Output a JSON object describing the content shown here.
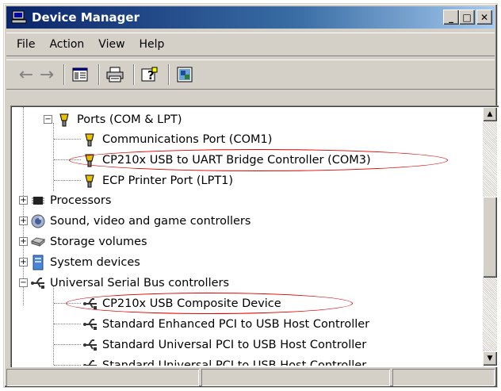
{
  "window": {
    "title": "Device Manager",
    "controls": {
      "minimize": "_",
      "maximize": "□",
      "close": "✕"
    }
  },
  "menu": [
    {
      "label": "File"
    },
    {
      "label": "Action"
    },
    {
      "label": "View"
    },
    {
      "label": "Help"
    }
  ],
  "toolbar": {
    "icons": [
      "back-arrow-icon",
      "forward-arrow-icon",
      "properties-icon",
      "print-icon",
      "help-icon",
      "update-driver-icon"
    ]
  },
  "tree": {
    "ports": {
      "label": "Ports (COM & LPT)",
      "children": [
        "Communications Port (COM1)",
        "CP210x USB to UART Bridge Controller (COM3)",
        "ECP Printer Port (LPT1)"
      ]
    },
    "categories": {
      "processors": "Processors",
      "sound": "Sound, video and game controllers",
      "storage": "Storage volumes",
      "system": "System devices"
    },
    "usb": {
      "label": "Universal Serial Bus controllers",
      "children": [
        "CP210x USB Composite Device",
        "Standard Enhanced PCI to USB Host Controller",
        "Standard Universal PCI to USB Host Controller",
        "Standard Universal PCI to USB Host Controller"
      ]
    }
  },
  "colors": {
    "highlight": "#e00000",
    "title_bar_start": "#0a246a",
    "title_bar_end": "#a6caf0",
    "face": "#d4d0c8"
  }
}
